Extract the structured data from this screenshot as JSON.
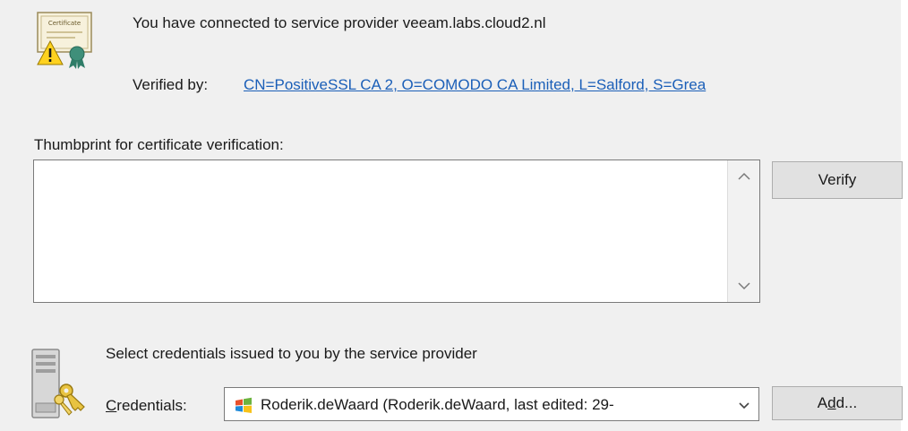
{
  "provider": {
    "connected_text": "You have connected to service provider veeam.labs.cloud2.nl",
    "verified_label": "Verified by:",
    "verified_link": "CN=PositiveSSL CA 2, O=COMODO CA Limited, L=Salford, S=Grea"
  },
  "thumbprint": {
    "label": "Thumbprint for certificate verification:",
    "value": "",
    "verify_label": "Verify"
  },
  "credentials": {
    "select_text": "Select credentials issued to you by the service provider",
    "label_underlined": "C",
    "label_rest": "redentials:",
    "selected_value": "Roderik.deWaard (Roderik.deWaard, last edited: 29-",
    "add_label_part1": "A",
    "add_label_underlined": "d",
    "add_label_part2": "d..."
  },
  "icons": {
    "certificate": "certificate-warning-icon",
    "keys": "server-keys-icon",
    "account": "windows-account-icon"
  },
  "colors": {
    "panel_bg": "#f0f0f0",
    "link": "#1b5fb8",
    "button_bg": "#e1e1e1",
    "button_border": "#adadad"
  }
}
